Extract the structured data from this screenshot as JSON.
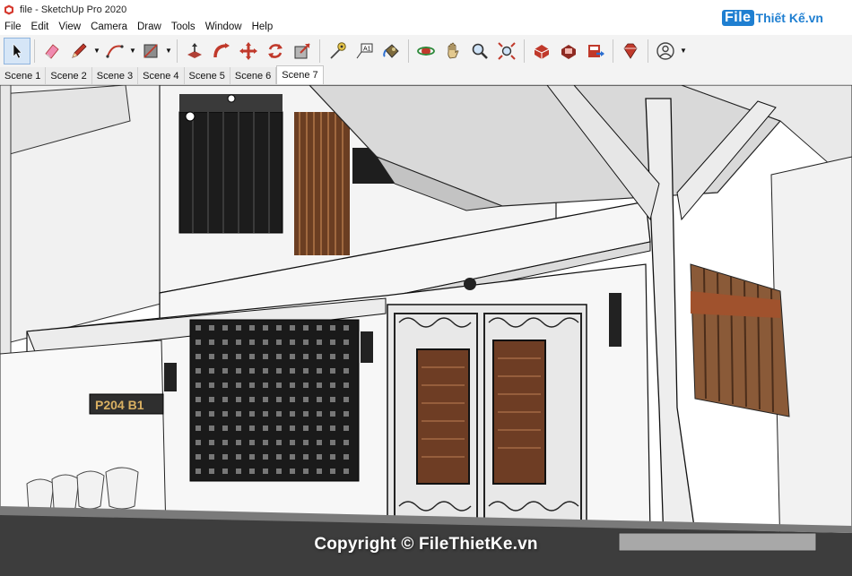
{
  "window": {
    "title": "file - SketchUp Pro 2020"
  },
  "brand": {
    "file": "File",
    "rest": "Thiết Kế.vn"
  },
  "menu": [
    "File",
    "Edit",
    "View",
    "Camera",
    "Draw",
    "Tools",
    "Window",
    "Help"
  ],
  "toolbar": {
    "tools": [
      {
        "name": "select-tool",
        "icon": "cursor-arrow",
        "active": true
      },
      {
        "name": "eraser-tool",
        "icon": "eraser"
      },
      {
        "name": "line-tool",
        "icon": "pencil",
        "dropdown": true
      },
      {
        "name": "arc-tool",
        "icon": "arc",
        "dropdown": true
      },
      {
        "name": "shape-tool",
        "icon": "rectangle",
        "dropdown": true
      },
      {
        "name": "pushpull-tool",
        "icon": "push-pull"
      },
      {
        "name": "followme-tool",
        "icon": "follow-me"
      },
      {
        "name": "move-tool",
        "icon": "move-arrows"
      },
      {
        "name": "rotate-tool",
        "icon": "rotate"
      },
      {
        "name": "scale-tool",
        "icon": "scale"
      },
      {
        "name": "tape-measure-tool",
        "icon": "tape-measure"
      },
      {
        "name": "text-tool",
        "icon": "text-a1"
      },
      {
        "name": "paint-bucket-tool",
        "icon": "paint-bucket"
      },
      {
        "name": "orbit-tool",
        "icon": "orbit"
      },
      {
        "name": "pan-tool",
        "icon": "hand"
      },
      {
        "name": "zoom-tool",
        "icon": "magnifier"
      },
      {
        "name": "zoom-extents-tool",
        "icon": "zoom-extents"
      },
      {
        "name": "warehouse-tool",
        "icon": "3d-warehouse"
      },
      {
        "name": "extension-warehouse-tool",
        "icon": "extension-warehouse"
      },
      {
        "name": "send-to-layout-tool",
        "icon": "layout"
      },
      {
        "name": "ruby-console-tool",
        "icon": "ruby-gem"
      },
      {
        "name": "account-tool",
        "icon": "user-account",
        "dropdown": true
      }
    ]
  },
  "scenes": [
    {
      "label": "Scene 1",
      "active": false
    },
    {
      "label": "Scene 2",
      "active": false
    },
    {
      "label": "Scene 3",
      "active": false
    },
    {
      "label": "Scene 4",
      "active": false
    },
    {
      "label": "Scene 5",
      "active": false
    },
    {
      "label": "Scene 6",
      "active": false
    },
    {
      "label": "Scene 7",
      "active": true
    }
  ],
  "model": {
    "house_number": "P204 B1"
  },
  "watermark": "Copyright © FileThietKe.vn",
  "colors": {
    "accent": "#1f7fd1",
    "toolbar_bg": "#f3f3f3",
    "wood": "#7a4a2c"
  }
}
